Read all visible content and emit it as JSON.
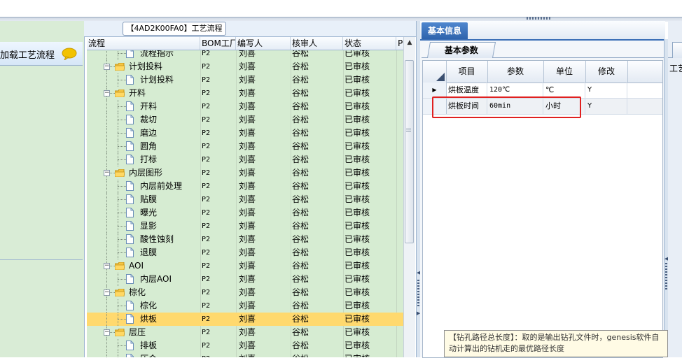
{
  "left_panel": {
    "title": "加载工艺流程",
    "icon": "speech-bubble-icon",
    "icon_color": "#f2c200"
  },
  "process_window": {
    "title": "【4AD2K00FA0】工艺流程",
    "columns": [
      "流程",
      "BOM工厂",
      "编写人",
      "核审人",
      "状态",
      "P"
    ],
    "rows": [
      {
        "name": "流程指示",
        "level": 1,
        "type": "doc",
        "bom": "P2",
        "writer": "刘喜",
        "reviewer": "谷松",
        "status": "已审核"
      },
      {
        "name": "计划投料",
        "level": 0,
        "type": "folder",
        "bom": "P2",
        "writer": "刘喜",
        "reviewer": "谷松",
        "status": "已审核"
      },
      {
        "name": "计划投料",
        "level": 1,
        "type": "doc",
        "bom": "P2",
        "writer": "刘喜",
        "reviewer": "谷松",
        "status": "已审核"
      },
      {
        "name": "开料",
        "level": 0,
        "type": "folder",
        "bom": "P2",
        "writer": "刘喜",
        "reviewer": "谷松",
        "status": "已审核"
      },
      {
        "name": "开料",
        "level": 1,
        "type": "doc",
        "bom": "P2",
        "writer": "刘喜",
        "reviewer": "谷松",
        "status": "已审核"
      },
      {
        "name": "裁切",
        "level": 1,
        "type": "doc",
        "bom": "P2",
        "writer": "刘喜",
        "reviewer": "谷松",
        "status": "已审核"
      },
      {
        "name": "磨边",
        "level": 1,
        "type": "doc",
        "bom": "P2",
        "writer": "刘喜",
        "reviewer": "谷松",
        "status": "已审核"
      },
      {
        "name": "圆角",
        "level": 1,
        "type": "doc",
        "bom": "P2",
        "writer": "刘喜",
        "reviewer": "谷松",
        "status": "已审核"
      },
      {
        "name": "打标",
        "level": 1,
        "type": "doc",
        "bom": "P2",
        "writer": "刘喜",
        "reviewer": "谷松",
        "status": "已审核"
      },
      {
        "name": "内层图形",
        "level": 0,
        "type": "folder",
        "bom": "P2",
        "writer": "刘喜",
        "reviewer": "谷松",
        "status": "已审核"
      },
      {
        "name": "内层前处理",
        "level": 1,
        "type": "doc",
        "bom": "P2",
        "writer": "刘喜",
        "reviewer": "谷松",
        "status": "已审核"
      },
      {
        "name": "贴膜",
        "level": 1,
        "type": "doc",
        "bom": "P2",
        "writer": "刘喜",
        "reviewer": "谷松",
        "status": "已审核"
      },
      {
        "name": "曝光",
        "level": 1,
        "type": "doc",
        "bom": "P2",
        "writer": "刘喜",
        "reviewer": "谷松",
        "status": "已审核"
      },
      {
        "name": "显影",
        "level": 1,
        "type": "doc",
        "bom": "P2",
        "writer": "刘喜",
        "reviewer": "谷松",
        "status": "已审核"
      },
      {
        "name": "酸性蚀刻",
        "level": 1,
        "type": "doc",
        "bom": "P2",
        "writer": "刘喜",
        "reviewer": "谷松",
        "status": "已审核"
      },
      {
        "name": "退膜",
        "level": 1,
        "type": "doc",
        "bom": "P2",
        "writer": "刘喜",
        "reviewer": "谷松",
        "status": "已审核"
      },
      {
        "name": "AOI",
        "level": 0,
        "type": "folder",
        "bom": "P2",
        "writer": "刘喜",
        "reviewer": "谷松",
        "status": "已审核"
      },
      {
        "name": "内层AOI",
        "level": 1,
        "type": "doc",
        "bom": "P2",
        "writer": "刘喜",
        "reviewer": "谷松",
        "status": "已审核"
      },
      {
        "name": "棕化",
        "level": 0,
        "type": "folder",
        "bom": "P2",
        "writer": "刘喜",
        "reviewer": "谷松",
        "status": "已审核"
      },
      {
        "name": "棕化",
        "level": 1,
        "type": "doc",
        "bom": "P2",
        "writer": "刘喜",
        "reviewer": "谷松",
        "status": "已审核"
      },
      {
        "name": "烘板",
        "level": 1,
        "type": "doc",
        "bom": "P2",
        "writer": "刘喜",
        "reviewer": "谷松",
        "status": "已审核",
        "selected": true
      },
      {
        "name": "层压",
        "level": 0,
        "type": "folder",
        "bom": "P2",
        "writer": "刘喜",
        "reviewer": "谷松",
        "status": "已审核"
      },
      {
        "name": "排板",
        "level": 1,
        "type": "doc",
        "bom": "P2",
        "writer": "刘喜",
        "reviewer": "谷松",
        "status": "已审核"
      },
      {
        "name": "压合",
        "level": 1,
        "type": "doc",
        "bom": "P2",
        "writer": "刘喜",
        "reviewer": "谷松",
        "status": "已审核"
      }
    ]
  },
  "basic_info": {
    "tab": "基本信息",
    "subtab": "基本参数",
    "columns": [
      "项目",
      "参数",
      "单位",
      "修改"
    ],
    "rows": [
      {
        "item": "烘板温度",
        "param": "120℃",
        "unit": "℃",
        "edit": "Y",
        "current": true
      },
      {
        "item": "烘板时间",
        "param": "60min",
        "unit": "小时",
        "edit": "Y",
        "current": false
      }
    ]
  },
  "far_right": {
    "label": "工艺"
  },
  "tooltip": {
    "text": "【钻孔路径总长度】：取的是输出钻孔文件时，genesis软件自动计算出的钻机走的最优路径长度"
  },
  "colors": {
    "grid_bg": "#d6ecd2",
    "selection": "#ffd96e",
    "tab_blue": "#2e63ac",
    "highlight_box": "#e02020"
  }
}
